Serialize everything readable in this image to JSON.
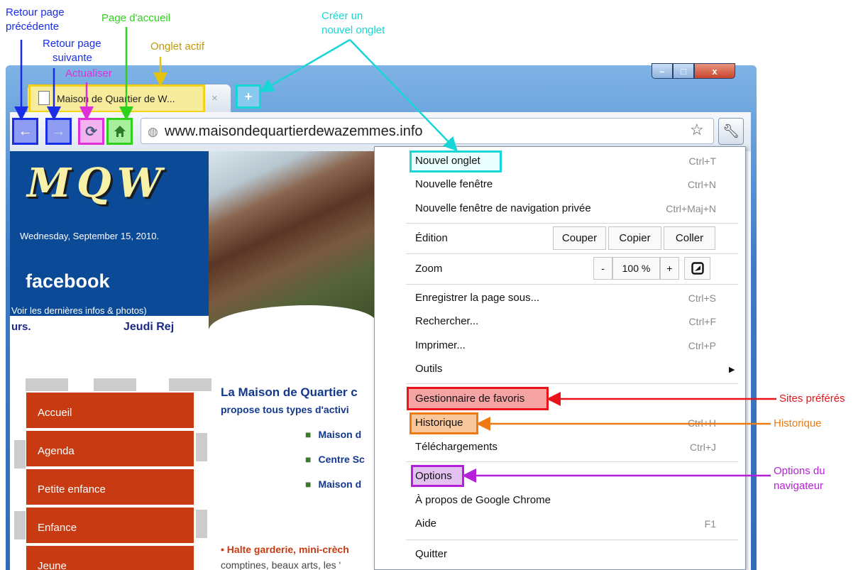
{
  "annotations": {
    "back": "Retour page\nprécédente",
    "back_l1": "Retour page",
    "back_l2": "précédente",
    "forward_l1": "Retour page",
    "forward_l2": "suivante",
    "home": "Page d'accueil",
    "active_tab": "Onglet actif",
    "reload": "Actualiser",
    "new_tab_l1": "Créer un",
    "new_tab_l2": "nouvel onglet",
    "favorites": "Sites préférés",
    "history": "Historique",
    "options_l1": "Options du",
    "options_l2": "navigateur",
    "colors": {
      "blue": "#1a2ee8",
      "green": "#2fd11c",
      "gold": "#c09a0a",
      "cyan": "#19d6d6",
      "magenta": "#e02fd8",
      "red": "#e8131b",
      "orange": "#ee7a12",
      "purple": "#b51fd9"
    }
  },
  "browser": {
    "tab_title": "Maison de Quartier de W...",
    "tab_close": "×",
    "new_tab_symbol": "+",
    "url": "www.maisondequartierdewazemmes.info",
    "icons": {
      "back": "back-arrow-icon",
      "forward": "forward-arrow-icon",
      "reload": "reload-icon",
      "home": "home-icon",
      "globe": "globe-icon",
      "star": "star-icon",
      "wrench": "wrench-icon"
    },
    "window_buttons": {
      "min": "–",
      "max": "□",
      "close": "x"
    }
  },
  "page": {
    "logo": "MQW",
    "date": "Wednesday, September 15, 2010.",
    "facebook": "facebook",
    "facebook_sub": "Voir les dernières infos & photos)",
    "marquee_left": "urs.",
    "marquee_right": "Jeudi Rej",
    "menu": [
      "Accueil",
      "Agenda",
      "Petite enfance",
      "Enfance",
      "Jeune"
    ],
    "heading": "La Maison de Quartier c",
    "subheading": "propose tous types d'activi",
    "bullets": [
      "Maison d",
      "Centre Sc",
      "Maison d"
    ],
    "halte_a": "Halte garderie",
    "halte_b": ", mini-crèch",
    "comptines": "comptines, beaux arts, les '"
  },
  "menu": {
    "items": [
      {
        "label": "Nouvel onglet",
        "shortcut": "Ctrl+T"
      },
      {
        "label": "Nouvelle fenêtre",
        "shortcut": "Ctrl+N"
      },
      {
        "label": "Nouvelle fenêtre de navigation privée",
        "shortcut": "Ctrl+Maj+N"
      },
      {
        "label": "Édition",
        "shortcut": ""
      },
      {
        "label": "Zoom",
        "shortcut": ""
      },
      {
        "label": "Enregistrer la page sous...",
        "shortcut": "Ctrl+S"
      },
      {
        "label": "Rechercher...",
        "shortcut": "Ctrl+F"
      },
      {
        "label": "Imprimer...",
        "shortcut": "Ctrl+P"
      },
      {
        "label": "Outils",
        "shortcut": ""
      },
      {
        "label": "Gestionnaire de favoris",
        "shortcut": ""
      },
      {
        "label": "Historique",
        "shortcut": "Ctrl+H"
      },
      {
        "label": "Téléchargements",
        "shortcut": "Ctrl+J"
      },
      {
        "label": "Options",
        "shortcut": ""
      },
      {
        "label": "À propos de Google Chrome",
        "shortcut": ""
      },
      {
        "label": "Aide",
        "shortcut": "F1"
      },
      {
        "label": "Quitter",
        "shortcut": ""
      }
    ],
    "edit": {
      "cut": "Couper",
      "copy": "Copier",
      "paste": "Coller"
    },
    "zoom": {
      "minus": "-",
      "value": "100 %",
      "plus": "+",
      "fullscreen_icon": "fullscreen-icon"
    },
    "submenu_arrow": "▶"
  }
}
